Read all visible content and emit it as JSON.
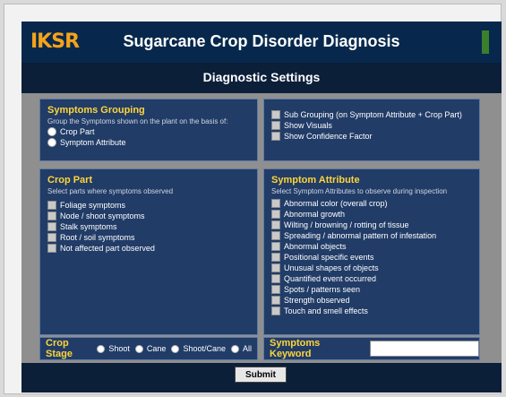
{
  "app": {
    "logo": "IKSR",
    "title": "Sugarcane Crop Disorder Diagnosis"
  },
  "settings": {
    "title": "Diagnostic Settings"
  },
  "symptoms_grouping": {
    "title": "Symptoms Grouping",
    "desc": "Group the Symptoms shown on the plant on the basis of:",
    "options": [
      {
        "label": "Crop Part",
        "selected": true
      },
      {
        "label": "Symptom Attribute",
        "selected": false
      }
    ]
  },
  "options_panel": {
    "items": [
      {
        "label": "Sub Grouping (on Symptom Attribute + Crop Part)",
        "checked": true
      },
      {
        "label": "Show Visuals",
        "checked": true
      },
      {
        "label": "Show Confidence Factor",
        "checked": true
      }
    ]
  },
  "crop_part": {
    "title": "Crop Part",
    "desc": "Select parts where symptoms observed",
    "items": [
      {
        "label": "Foliage symptoms",
        "checked": true
      },
      {
        "label": "Node / shoot symptoms",
        "checked": true
      },
      {
        "label": "Stalk symptoms",
        "checked": true
      },
      {
        "label": "Root / soil symptoms",
        "checked": true
      },
      {
        "label": "Not affected part observed",
        "checked": true
      }
    ]
  },
  "symptom_attribute": {
    "title": "Symptom Attribute",
    "desc": "Select Symptom Attributes to observe during inspection",
    "items": [
      {
        "label": "Abnormal color (overall crop)",
        "checked": true
      },
      {
        "label": "Abnormal growth",
        "checked": true
      },
      {
        "label": "Wilting / browning / rotting of tissue",
        "checked": true
      },
      {
        "label": "Spreading / abnormal pattern of infestation",
        "checked": true
      },
      {
        "label": "Abnormal objects",
        "checked": true
      },
      {
        "label": "Positional specific events",
        "checked": true
      },
      {
        "label": "Unusual shapes of objects",
        "checked": true
      },
      {
        "label": "Quantified event occurred",
        "checked": true
      },
      {
        "label": "Spots / patterns seen",
        "checked": true
      },
      {
        "label": "Strength observed",
        "checked": true
      },
      {
        "label": "Touch and smell effects",
        "checked": true
      }
    ]
  },
  "crop_stage": {
    "label": "Crop Stage",
    "options": [
      {
        "label": "Shoot",
        "selected": false
      },
      {
        "label": "Cane",
        "selected": false
      },
      {
        "label": "Shoot/Cane",
        "selected": false
      },
      {
        "label": "All",
        "selected": true
      }
    ]
  },
  "keyword": {
    "label": "Symptoms Keyword",
    "value": ""
  },
  "actions": {
    "submit": "Submit"
  },
  "colors": {
    "header_bg": "#07284c",
    "box_bg": "#213c67",
    "heading_yellow": "#ffd53a"
  }
}
